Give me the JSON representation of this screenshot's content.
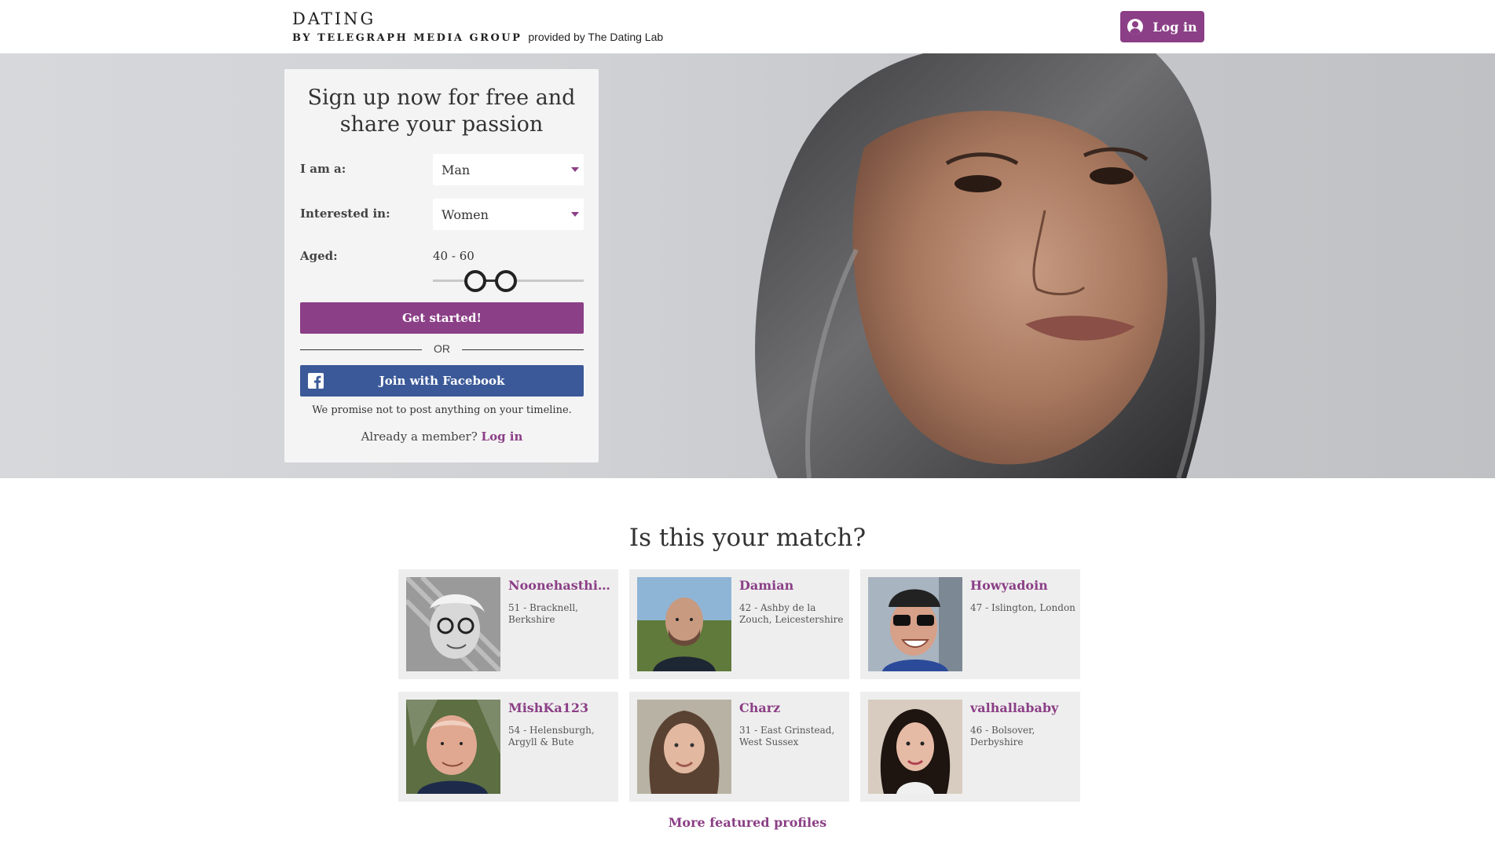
{
  "header": {
    "brand_title": "DATING",
    "brand_subtitle": "BY TELEGRAPH MEDIA GROUP",
    "provided_by": "provided by The Dating Lab",
    "login_label": "Log in"
  },
  "signup": {
    "title": "Sign up now for free and share your passion",
    "gender_label": "I am a:",
    "gender_value": "Man",
    "interest_label": "Interested in:",
    "interest_value": "Women",
    "age_label": "Aged:",
    "age_value": "40 - 60",
    "age_min": 40,
    "age_max": 60,
    "cta_label": "Get started!",
    "or_label": "OR",
    "facebook_label": "Join with Facebook",
    "facebook_note": "We promise not to post anything on your timeline.",
    "member_prompt": "Already a member?",
    "member_login": "Log in"
  },
  "matches": {
    "title": "Is this your match?",
    "profiles": [
      {
        "name": "Noonehasthis...",
        "info": "51 - Bracknell, Berkshire"
      },
      {
        "name": "Damian",
        "info": "42 - Ashby de la Zouch, Leicestershire"
      },
      {
        "name": "Howyadoin",
        "info": "47 - Islington, London"
      },
      {
        "name": "MishKa123",
        "info": "54 - Helensburgh, Argyll & Bute"
      },
      {
        "name": "Charz",
        "info": "31 - East Grinstead, West Sussex"
      },
      {
        "name": "valhallababy",
        "info": "46 - Bolsover, Derbyshire"
      }
    ],
    "more_label": "More featured profiles"
  },
  "colors": {
    "accent": "#8b3f86",
    "facebook": "#3b5998"
  }
}
